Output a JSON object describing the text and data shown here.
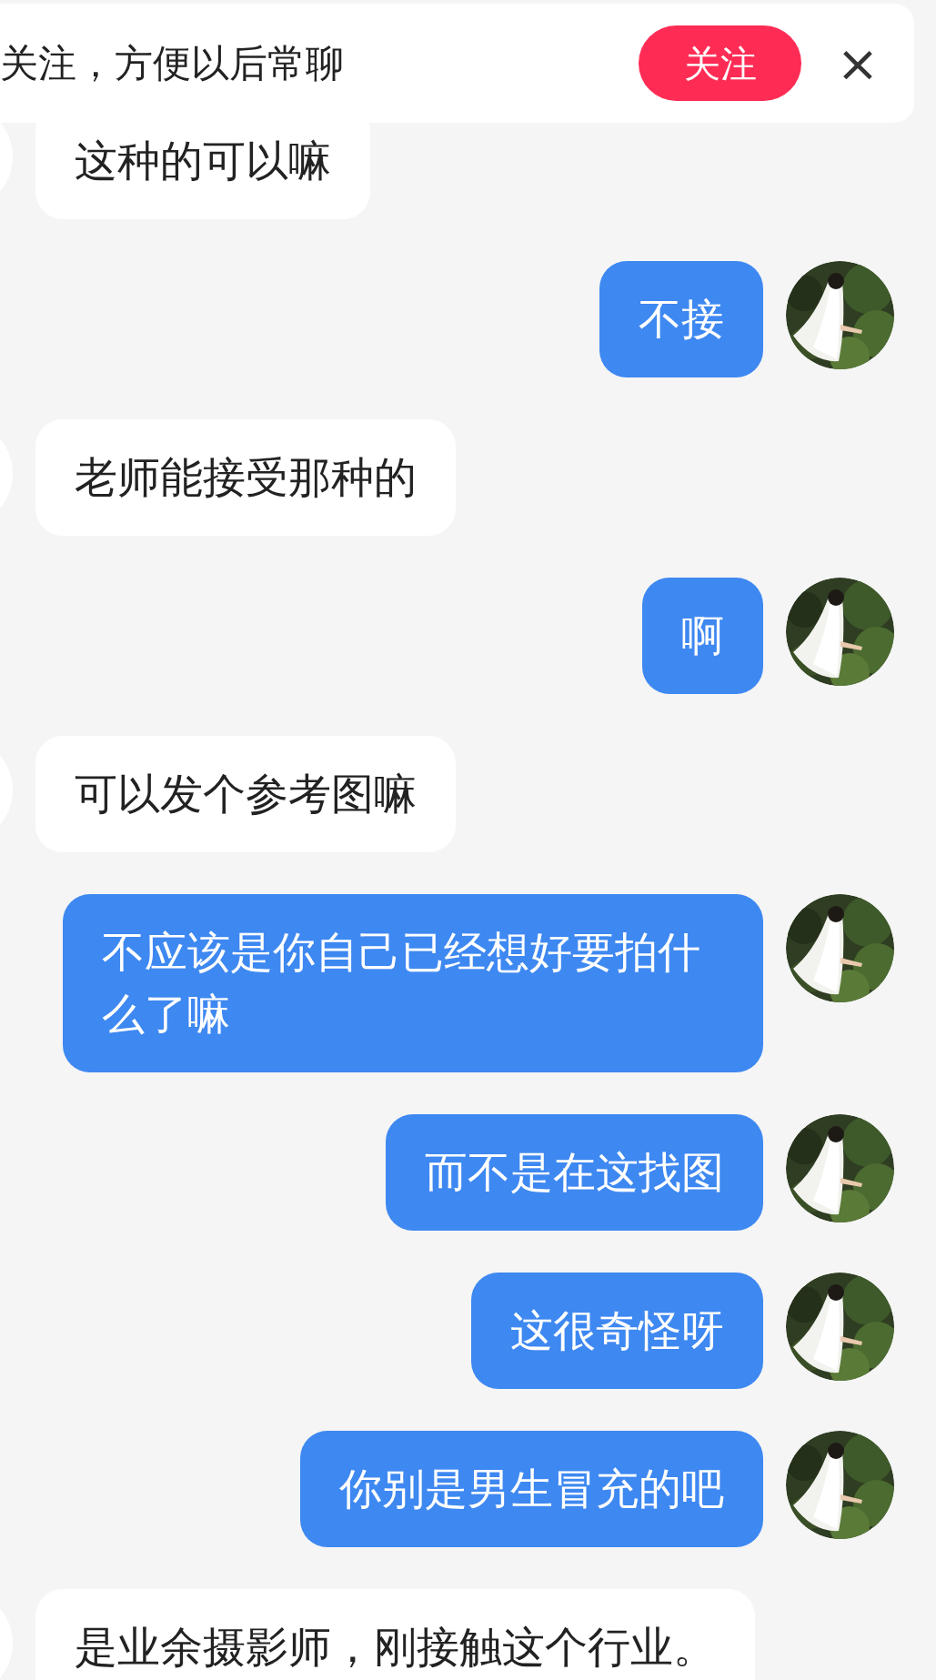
{
  "banner": {
    "text": "关注，方便以后常聊",
    "follow_button": "关注",
    "close_button": "×"
  },
  "messages": [
    {
      "kind": "received",
      "text": "这种的可以嘛"
    },
    {
      "kind": "sent",
      "text": "不接"
    },
    {
      "kind": "received",
      "text": "老师能接受那种的"
    },
    {
      "kind": "sent",
      "text": "啊"
    },
    {
      "kind": "received",
      "text": "可以发个参考图嘛"
    },
    {
      "kind": "sent",
      "text": "不应该是你自己已经想好要拍什么了嘛"
    },
    {
      "kind": "sent",
      "text": "而不是在这找图"
    },
    {
      "kind": "sent",
      "text": "这很奇怪呀"
    },
    {
      "kind": "sent",
      "text": "你别是男生冒充的吧"
    },
    {
      "kind": "received",
      "text": "是业余摄影师，刚接触这个行业。"
    }
  ]
}
